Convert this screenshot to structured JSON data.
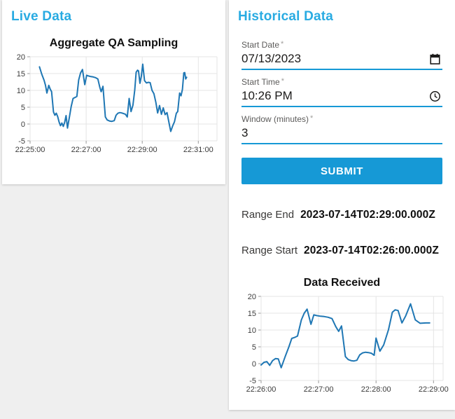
{
  "colors": {
    "accent_blue": "#29abe2",
    "primary_blue": "#1699d6",
    "line_blue": "#1f77b4",
    "grid": "#e4e4e4",
    "tick_stub": "#999999"
  },
  "live_panel": {
    "title": "Live Data"
  },
  "historical_panel": {
    "title": "Historical Data",
    "fields": [
      {
        "label": "Start Date",
        "required_marker": "*",
        "value": "07/13/2023",
        "icon": "calendar-icon"
      },
      {
        "label": "Start Time",
        "required_marker": "*",
        "value": "10:26 PM",
        "icon": "clock-icon"
      },
      {
        "label": "Window (minutes)",
        "required_marker": "*",
        "value": "3",
        "icon": "none"
      }
    ],
    "submit_label": "SUBMIT",
    "results": [
      {
        "label": "Range End",
        "value": "2023-07-14T02:29:00.000Z"
      },
      {
        "label": "Range Start",
        "value": "2023-07-14T02:26:00.000Z"
      }
    ]
  },
  "chart_data": [
    {
      "type": "line",
      "title": "Aggregate QA Sampling",
      "xlabel": "",
      "ylabel": "",
      "x_unit": "seconds after 22:25:00",
      "x_domain": [
        0,
        400
      ],
      "y_domain": [
        -5,
        20
      ],
      "x_ticks": [
        {
          "pos": 0,
          "label": "22:25:00"
        },
        {
          "pos": 120,
          "label": "22:27:00"
        },
        {
          "pos": 240,
          "label": "22:29:00"
        },
        {
          "pos": 360,
          "label": "22:31:00"
        }
      ],
      "y_ticks": [
        -5,
        0,
        5,
        10,
        15,
        20
      ],
      "grid": true,
      "legend": false,
      "points": [
        [
          20,
          17
        ],
        [
          25,
          14.8
        ],
        [
          30,
          13
        ],
        [
          33,
          11.5
        ],
        [
          36,
          9.2
        ],
        [
          40,
          11.5
        ],
        [
          43,
          10.4
        ],
        [
          46,
          9.6
        ],
        [
          50,
          3.6
        ],
        [
          53,
          2.6
        ],
        [
          56,
          3.2
        ],
        [
          59,
          2.2
        ],
        [
          62,
          0.6
        ],
        [
          65,
          -0.5
        ],
        [
          68,
          0.3
        ],
        [
          71,
          -0.7
        ],
        [
          74,
          0.5
        ],
        [
          77,
          2.5
        ],
        [
          80,
          -1.2
        ],
        [
          84,
          2.0
        ],
        [
          88,
          5.2
        ],
        [
          92,
          7.6
        ],
        [
          96,
          7.9
        ],
        [
          100,
          8.2
        ],
        [
          104,
          13.1
        ],
        [
          108,
          15.2
        ],
        [
          112,
          16.2
        ],
        [
          117,
          11.7
        ],
        [
          121,
          14.5
        ],
        [
          125,
          14.3
        ],
        [
          130,
          14.1
        ],
        [
          135,
          14.0
        ],
        [
          140,
          13.8
        ],
        [
          145,
          13.4
        ],
        [
          149,
          11.0
        ],
        [
          152,
          9.6
        ],
        [
          156,
          11.2
        ],
        [
          161,
          2.1
        ],
        [
          165,
          1.2
        ],
        [
          170,
          0.9
        ],
        [
          175,
          0.8
        ],
        [
          180,
          1.0
        ],
        [
          184,
          2.6
        ],
        [
          188,
          3.2
        ],
        [
          192,
          3.4
        ],
        [
          196,
          3.3
        ],
        [
          200,
          3.1
        ],
        [
          204,
          2.9
        ],
        [
          208,
          2.1
        ],
        [
          212,
          7.6
        ],
        [
          216,
          3.7
        ],
        [
          220,
          5.6
        ],
        [
          224,
          10.1
        ],
        [
          227,
          15.4
        ],
        [
          230,
          16.0
        ],
        [
          232,
          15.8
        ],
        [
          235,
          12.1
        ],
        [
          238,
          14.2
        ],
        [
          241,
          17.8
        ],
        [
          245,
          12.9
        ],
        [
          249,
          12.2
        ],
        [
          253,
          12.4
        ],
        [
          257,
          12.3
        ],
        [
          261,
          10.0
        ],
        [
          265,
          9.0
        ],
        [
          269,
          6.5
        ],
        [
          273,
          3.3
        ],
        [
          277,
          5.5
        ],
        [
          281,
          2.9
        ],
        [
          285,
          4.8
        ],
        [
          289,
          2.8
        ],
        [
          293,
          3.4
        ],
        [
          297,
          0.6
        ],
        [
          301,
          -2.2
        ],
        [
          305,
          -0.6
        ],
        [
          309,
          0.7
        ],
        [
          313,
          3.2
        ],
        [
          316,
          3.7
        ],
        [
          320,
          9.2
        ],
        [
          323,
          8.4
        ],
        [
          326,
          10.3
        ],
        [
          329,
          15.2
        ],
        [
          331,
          15.3
        ],
        [
          333,
          13.4
        ],
        [
          335,
          13.9
        ]
      ]
    },
    {
      "type": "line",
      "title": "Data Received",
      "xlabel": "",
      "ylabel": "",
      "x_unit": "seconds after 22:26:00",
      "x_domain": [
        0,
        190
      ],
      "y_domain": [
        -5,
        20
      ],
      "x_ticks": [
        {
          "pos": 0,
          "label": "22:26:00"
        },
        {
          "pos": 60,
          "label": "22:27:00"
        },
        {
          "pos": 120,
          "label": "22:28:00"
        },
        {
          "pos": 180,
          "label": "22:29:00"
        }
      ],
      "y_ticks": [
        -5,
        0,
        5,
        10,
        15,
        20
      ],
      "grid": true,
      "legend": false,
      "points": [
        [
          0,
          -0.4
        ],
        [
          3,
          0.4
        ],
        [
          6,
          0.6
        ],
        [
          9,
          -0.5
        ],
        [
          12,
          0.9
        ],
        [
          15,
          1.5
        ],
        [
          18,
          1.4
        ],
        [
          21,
          -1.2
        ],
        [
          25,
          2.0
        ],
        [
          29,
          5.0
        ],
        [
          32,
          7.5
        ],
        [
          35,
          7.8
        ],
        [
          38,
          8.2
        ],
        [
          42,
          13.0
        ],
        [
          45,
          15.0
        ],
        [
          48,
          16.2
        ],
        [
          52,
          11.7
        ],
        [
          55,
          14.5
        ],
        [
          58,
          14.3
        ],
        [
          62,
          14.1
        ],
        [
          66,
          14.0
        ],
        [
          70,
          13.8
        ],
        [
          74,
          13.4
        ],
        [
          78,
          11.0
        ],
        [
          81,
          9.6
        ],
        [
          84,
          11.2
        ],
        [
          88,
          2.1
        ],
        [
          91,
          1.2
        ],
        [
          94,
          0.9
        ],
        [
          97,
          0.8
        ],
        [
          100,
          1.0
        ],
        [
          103,
          2.6
        ],
        [
          106,
          3.2
        ],
        [
          109,
          3.4
        ],
        [
          112,
          3.3
        ],
        [
          115,
          3.1
        ],
        [
          118,
          2.5
        ],
        [
          120,
          7.6
        ],
        [
          124,
          3.7
        ],
        [
          128,
          5.6
        ],
        [
          133,
          10.1
        ],
        [
          137,
          15.3
        ],
        [
          140,
          16.0
        ],
        [
          143,
          15.8
        ],
        [
          147,
          12.1
        ],
        [
          151,
          14.2
        ],
        [
          156,
          17.8
        ],
        [
          161,
          13.0
        ],
        [
          166,
          12.0
        ],
        [
          172,
          12.1
        ],
        [
          176,
          12.1
        ]
      ]
    }
  ]
}
